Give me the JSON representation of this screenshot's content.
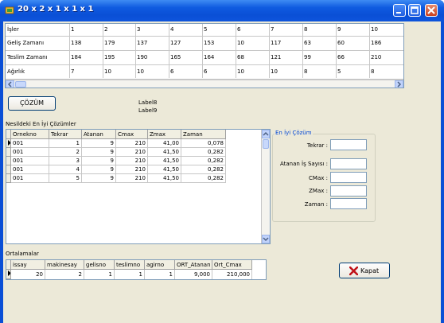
{
  "window": {
    "title": "20 x 2 x 1 x 1 x 1"
  },
  "top_grid": {
    "headers": [
      "İşler",
      "1",
      "2",
      "3",
      "4",
      "5",
      "6",
      "7",
      "8",
      "9",
      "10"
    ],
    "rows": [
      [
        "Geliş Zamanı",
        "138",
        "179",
        "137",
        "127",
        "153",
        "10",
        "117",
        "63",
        "60",
        "186"
      ],
      [
        "Teslim Zamanı",
        "184",
        "195",
        "190",
        "165",
        "164",
        "68",
        "121",
        "99",
        "66",
        "210"
      ],
      [
        "Ağırlık",
        "7",
        "10",
        "10",
        "6",
        "6",
        "10",
        "10",
        "8",
        "5",
        "8"
      ]
    ]
  },
  "cozum_button": "ÇÖZÜM",
  "label8": "Label8",
  "label9": "Label9",
  "nesil_label": "Nesildeki En İyi Çözümler",
  "nesil_grid": {
    "headers": [
      "Ornekno",
      "Tekrar",
      "Atanan",
      "Cmax",
      "Zmax",
      "Zaman"
    ],
    "rows": [
      [
        "001",
        "1",
        "9",
        "210",
        "41,00",
        "0,078"
      ],
      [
        "001",
        "2",
        "9",
        "210",
        "41,50",
        "0,282"
      ],
      [
        "001",
        "3",
        "9",
        "210",
        "41,50",
        "0,282"
      ],
      [
        "001",
        "4",
        "9",
        "210",
        "41,50",
        "0,282"
      ],
      [
        "001",
        "5",
        "9",
        "210",
        "41,50",
        "0,282"
      ]
    ]
  },
  "best": {
    "group_title": "En İyi Çözüm",
    "tekrar": "Tekrar :",
    "atanan": "Atanan İş Sayısı :",
    "cmax": "CMax :",
    "zmax": "ZMax :",
    "zaman": "Zaman :"
  },
  "ort_label": "Ortalamalar",
  "ort_grid": {
    "headers": [
      "issay",
      "makinesay",
      "gelisno",
      "teslimno",
      "agirno",
      "ORT_Atanan",
      "Ort_Cmax"
    ],
    "row": [
      "20",
      "2",
      "1",
      "1",
      "1",
      "9,000",
      "210,000"
    ]
  },
  "kapat_button": "Kapat"
}
